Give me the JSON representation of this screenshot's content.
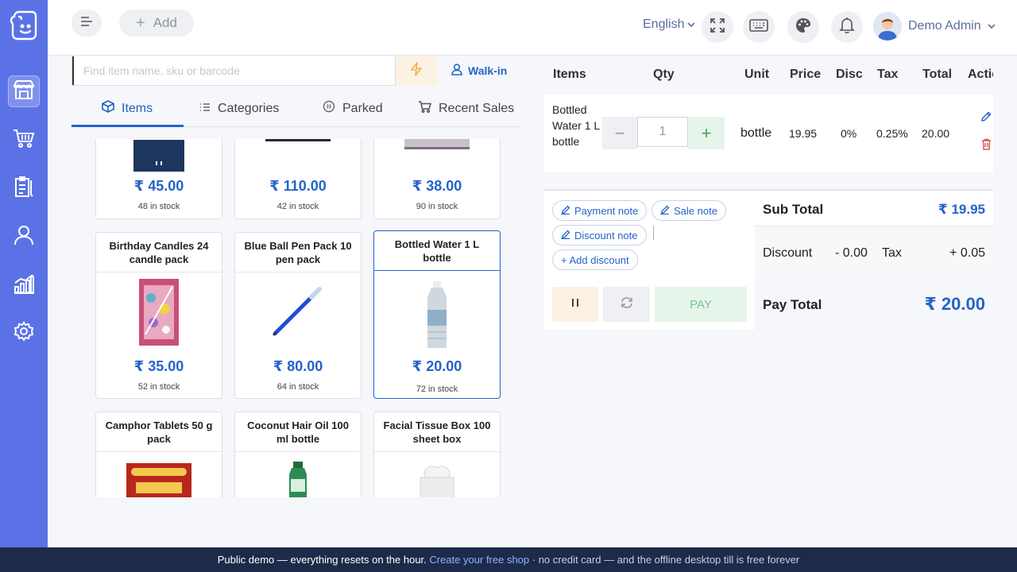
{
  "header": {
    "add_label": "Add",
    "language": "English",
    "user_name": "Demo Admin"
  },
  "search": {
    "placeholder": "Find item name, sku or barcode"
  },
  "customer": {
    "label": "Walk-in"
  },
  "tabs": [
    {
      "label": "Items",
      "active": true
    },
    {
      "label": "Categories"
    },
    {
      "label": "Parked"
    },
    {
      "label": "Recent Sales"
    }
  ],
  "products": [
    {
      "name": "",
      "price": "₹ 45.00",
      "stock": "48 in stock"
    },
    {
      "name": "",
      "price": "₹ 110.00",
      "stock": "42 in stock"
    },
    {
      "name": "",
      "price": "₹ 38.00",
      "stock": "90 in stock"
    },
    {
      "name": "Birthday Candles 24 candle pack",
      "price": "₹ 35.00",
      "stock": "52 in stock"
    },
    {
      "name": "Blue Ball Pen Pack 10 pen pack",
      "price": "₹ 80.00",
      "stock": "64 in stock"
    },
    {
      "name": "Bottled Water 1 L bottle",
      "price": "₹ 20.00",
      "stock": "72 in stock",
      "selected": true
    },
    {
      "name": "Camphor Tablets 50 g pack"
    },
    {
      "name": "Coconut Hair Oil 100 ml bottle"
    },
    {
      "name": "Facial Tissue Box 100 sheet box"
    }
  ],
  "cart": {
    "columns": [
      "Items",
      "Qty",
      "Unit",
      "Price",
      "Disc",
      "Tax",
      "Total",
      "Actio"
    ],
    "rows": [
      {
        "item": "Bottled Water 1 L bottle",
        "qty": "1",
        "unit": "bottle",
        "price": "19.95",
        "disc": "0%",
        "tax": "0.25%",
        "total": "20.00"
      }
    ]
  },
  "notes": {
    "payment_note": "Payment note",
    "sale_note": "Sale note",
    "discount_note": "Discount note",
    "add_discount": "+ Add discount"
  },
  "summary": {
    "sub_total_label": "Sub Total",
    "sub_total_value": "₹ 19.95",
    "discount_label": "Discount",
    "discount_value": "- 0.00",
    "tax_label": "Tax",
    "tax_value": "+ 0.05",
    "pay_total_label": "Pay Total",
    "pay_total_value": "₹ 20.00"
  },
  "actions": {
    "pay_label": "PAY"
  },
  "footer": {
    "text1": "Public demo — everything resets on the hour.",
    "link": "Create your free shop",
    "text2": "· no credit card — and the offline desktop till is free forever"
  },
  "colors": {
    "sidebar": "#5b72e6",
    "accent": "#2563c9",
    "footer": "#1e2a4a"
  }
}
